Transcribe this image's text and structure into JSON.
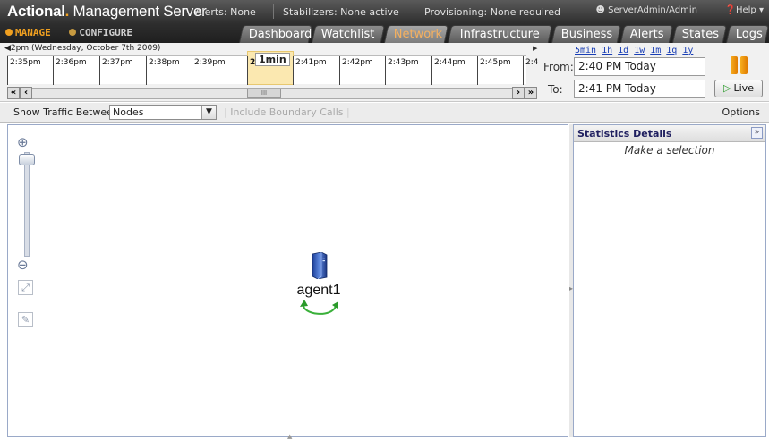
{
  "header": {
    "brand_name": "Actional",
    "brand_rest": "Management Server",
    "alerts_status": "Alerts: None",
    "stabilizers_status": "Stabilizers: None active",
    "provisioning_status": "Provisioning: None required",
    "user": "ServerAdmin/Admin",
    "help_label": "Help"
  },
  "modes": {
    "manage": "MANAGE",
    "configure": "CONFIGURE"
  },
  "tabs": [
    "Dashboard",
    "Watchlist",
    "Network",
    "Infrastructure",
    "Business",
    "Alerts",
    "States",
    "Logs"
  ],
  "active_tab": "Network",
  "timeline": {
    "caption": "2pm (Wednesday, October 7th 2009)",
    "ticks": [
      "2:35pm",
      "2:36pm",
      "2:37pm",
      "2:38pm",
      "2:39pm",
      "2",
      "",
      "2:41pm",
      "2:42pm",
      "2:43pm",
      "2:44pm",
      "2:45pm",
      "2:4"
    ],
    "window_label": "1min",
    "scroll_thumb": "III"
  },
  "range_links": [
    "5min",
    "1h",
    "1d",
    "1w",
    "1m",
    "1q",
    "1y"
  ],
  "time_range": {
    "from_label": "From:",
    "from_value": "2:40 PM Today",
    "to_label": "To:",
    "to_value": "2:41 PM Today",
    "live_label": "Live"
  },
  "toolbar": {
    "traffic_label": "Show Traffic Between",
    "traffic_value": "Nodes",
    "boundary_label": "Include Boundary Calls",
    "options_label": "Options"
  },
  "network": {
    "node_name": "agent1"
  },
  "stats": {
    "title": "Statistics Details",
    "empty_message": "Make a selection"
  },
  "colors": {
    "accent": "#f0a020",
    "header_bg": "#2e2e2e",
    "link": "#1a3fb5"
  }
}
